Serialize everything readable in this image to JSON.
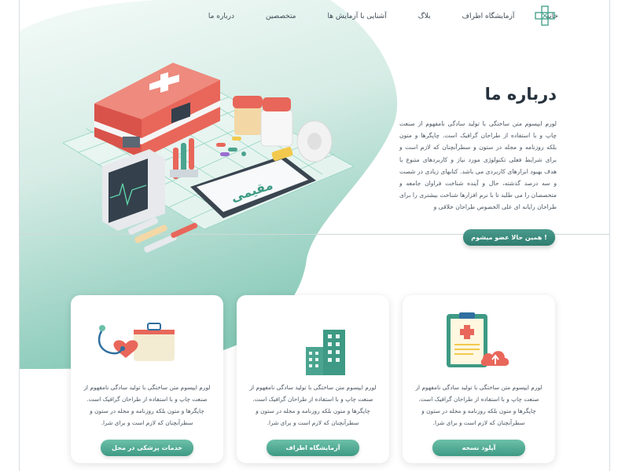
{
  "nav": {
    "items": [
      "خانه",
      "آزمایشگاه اطراف",
      "بلاگ",
      "آشنایی با آزمایش ها",
      "متخصصین",
      "درباره ما"
    ]
  },
  "hero": {
    "title": "درباره ما",
    "body": "لورم ایپسوم متن ساختگی با تولید سادگی نامفهوم از صنعت چاپ و با استفاده از طراحان گرافیک است. چاپگرها و متون بلکه روزنامه و مجله در ستون و سطرآنچنان که لازم است و برای شرایط فعلی تکنولوژی مورد نیاز و کاربردهای متنوع با هدف بهبود ابزارهای کاربردی می باشد. کتابهای زیادی در شصت و سه درصد گذشته، حال و آینده شناخت فراوان جامعه و متخصصان را می طلبد تا با نرم افزارها شناخت بیشتری را برای طراحان رایانه ای علی الخصوص طراحان خلاقی و",
    "cta_label": "همین حالا عضو میشوم !",
    "clipboard_label": "مقیمی"
  },
  "cards": [
    {
      "icon": "medical-kit-stethoscope-icon",
      "text": "لورم ایپسوم متن ساختگی با تولید سادگی نامفهوم از صنعت چاپ و با استفاده از طراحان گرافیک است. چاپگرها و متون بلکه روزنامه و مجله در ستون و سطرآنچنان که لازم است و برای شرا.",
      "button_label": "خدمات پزشکی در محل"
    },
    {
      "icon": "buildings-icon",
      "text": "لورم ایپسوم متن ساختگی با تولید سادگی نامفهوم از صنعت چاپ و با استفاده از طراحان گرافیک است. چاپگرها و متون بلکه روزنامه و مجله در ستون و سطرآنچنان که لازم است و برای شرا.",
      "button_label": "آزمایشگاه اطراف"
    },
    {
      "icon": "clipboard-upload-icon",
      "text": "لورم ایپسوم متن ساختگی با تولید سادگی نامفهوم از صنعت چاپ و با استفاده از طراحان گرافیک است. چاپگرها و متون بلکه روزنامه و مجله در ستون و سطرآنچنان که لازم است و برای شرا.",
      "button_label": "آپلود نسخه"
    }
  ],
  "colors": {
    "accent": "#3e9a84",
    "accent_dark": "#2f7e70",
    "blob_light": "#e4f3ee",
    "blob_mid": "#9fd3c4",
    "kit_red": "#e8675a",
    "heading": "#26323d"
  }
}
